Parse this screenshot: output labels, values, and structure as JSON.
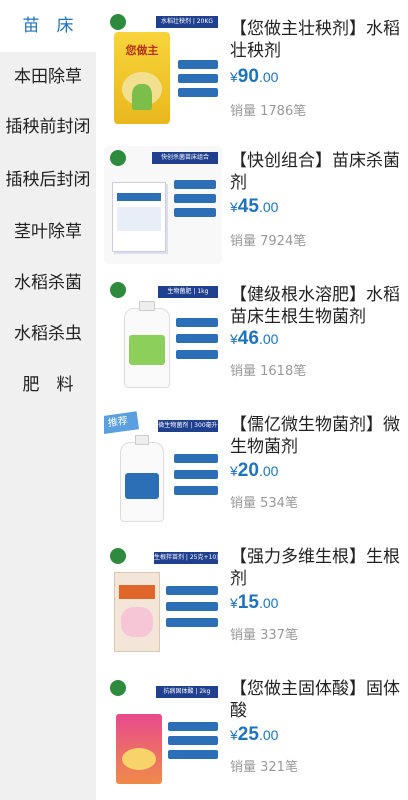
{
  "sidebar": {
    "items": [
      {
        "label": "苗　床",
        "active": true
      },
      {
        "label": "本田除草",
        "active": false
      },
      {
        "label": "插秧前封闭",
        "active": false
      },
      {
        "label": "插秧后封闭",
        "active": false
      },
      {
        "label": "茎叶除草",
        "active": false
      },
      {
        "label": "水稻杀菌",
        "active": false
      },
      {
        "label": "水稻杀虫",
        "active": false
      },
      {
        "label": "肥　料",
        "active": false
      }
    ]
  },
  "products": [
    {
      "title": "【您做主壮秧剂】水稻壮秧剂",
      "currency": "¥",
      "price_int": "90",
      "price_dec": ".00",
      "sales": "销量 1786笔",
      "pack_label": "水稻壮秧剂 | 20KG",
      "pack_brand": "您做主"
    },
    {
      "title": "【快创组合】苗床杀菌剂",
      "currency": "¥",
      "price_int": "45",
      "price_dec": ".00",
      "sales": "销量 7924笔",
      "pack_label": "快创杀菌苗床组合"
    },
    {
      "title": "【健级根水溶肥】水稻苗床生根生物菌剂",
      "currency": "¥",
      "price_int": "46",
      "price_dec": ".00",
      "sales": "销量 1618笔",
      "pack_label": "生物菌肥 | 1kg"
    },
    {
      "title": "【儒亿微生物菌剂】微生物菌剂",
      "currency": "¥",
      "price_int": "20",
      "price_dec": ".00",
      "sales": "销量 534笔",
      "pack_label": "微生物菌剂 | 300毫升",
      "badge": "推荐"
    },
    {
      "title": "【强力多维生根】生根剂",
      "currency": "¥",
      "price_int": "15",
      "price_dec": ".00",
      "sales": "销量 337笔",
      "pack_label": "生根拌苗剂 | 25克+10克"
    },
    {
      "title": "【您做主固体酸】固体酸",
      "currency": "¥",
      "price_int": "25",
      "price_dec": ".00",
      "sales": "销量 321笔",
      "pack_label": "抗病固体酸 | 2kg"
    }
  ],
  "colors": {
    "accent": "#1e73be",
    "sidebar_bg": "#f0f0f0",
    "sales_text": "#999999"
  }
}
